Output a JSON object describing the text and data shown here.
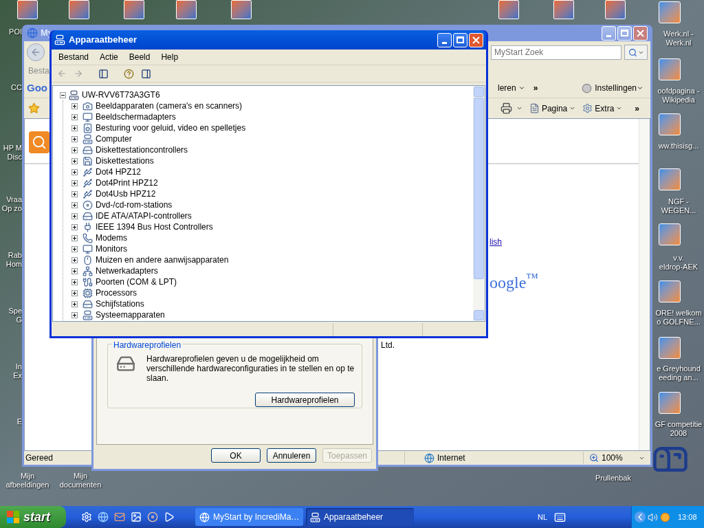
{
  "desktop": {
    "left_icons": [
      {
        "label_lines": [
          "POI"
        ]
      },
      {
        "label_lines": [
          "CC"
        ]
      },
      {
        "label_lines": [
          "HP M",
          "Disc"
        ]
      },
      {
        "label_lines": [
          "Vraa",
          "Op zo"
        ]
      },
      {
        "label_lines": [
          "Rab",
          "Hom"
        ]
      },
      {
        "label_lines": [
          "Spe",
          "G"
        ]
      },
      {
        "label_lines": [
          "In",
          "Ex"
        ]
      },
      {
        "label_lines": [
          "E"
        ]
      }
    ],
    "bottom_icons": [
      {
        "label_lines": [
          "Mijn",
          "afbeeldingen"
        ]
      },
      {
        "label_lines": [
          "Mijn",
          "documenten"
        ]
      }
    ],
    "right_icons": [
      {
        "label_lines": [
          "Werk.nl -",
          "Werk.nl"
        ]
      },
      {
        "label_lines": [
          "oofdpagina -",
          "Wikipedia"
        ]
      },
      {
        "label_lines": [
          "ww.thisisg..."
        ]
      },
      {
        "label_lines": [
          "NGF -",
          "WEGEN..."
        ]
      },
      {
        "label_lines": [
          "v.v.",
          "eldrop-AEK"
        ]
      },
      {
        "label_lines": [
          "ORE! welkom",
          "o GOLFNE..."
        ]
      },
      {
        "label_lines": [
          "e Greyhound",
          "eeding an..."
        ]
      },
      {
        "label_lines": [
          "GF competitie",
          "2008"
        ]
      }
    ],
    "recycle_bin": {
      "label": "Prullenbak"
    }
  },
  "browser_window": {
    "title": "My",
    "search_placeholder": "MyStart Zoek",
    "menu_fragment": "Besta",
    "google_logo": "Goo",
    "toolbar_fragment": "leren",
    "toolbar_overflow": "»",
    "settings": "Instellingen",
    "command_buttons": [
      {
        "label": "Pagina"
      },
      {
        "label": "Extra"
      }
    ],
    "command_overflow": "»",
    "link_fragment": "lish",
    "logo_fragment": "oogle$^{™}$",
    "text_fragment": "Ltd.",
    "status": "Gereed",
    "zone": "Internet",
    "zoom": "100%"
  },
  "system_properties": {
    "group_title": "Hardwareprofielen",
    "description": "Hardwareprofielen geven u de mogelijkheid om verschillende hardwareconfiguraties in te stellen en op te slaan.",
    "group_button": "Hardwareprofielen",
    "buttons": [
      {
        "label": "OK",
        "disabled": false
      },
      {
        "label": "Annuleren",
        "disabled": false
      },
      {
        "label": "Toepassen",
        "disabled": true
      }
    ]
  },
  "device_manager": {
    "title": "Apparaatbeheer",
    "menu": [
      "Bestand",
      "Actie",
      "Beeld",
      "Help"
    ],
    "tree": {
      "label": "UW-RVV6T73A3GT6",
      "expanded": true,
      "children": [
        {
          "label": "Beeldapparaten (camera's en scanners)",
          "expanded": false
        },
        {
          "label": "Beeldschermadapters",
          "expanded": false
        },
        {
          "label": "Besturing voor geluid, video en spelletjes",
          "expanded": false
        },
        {
          "label": "Computer",
          "expanded": false
        },
        {
          "label": "Diskettestationcontrollers",
          "expanded": false
        },
        {
          "label": "Diskettestations",
          "expanded": false
        },
        {
          "label": "Dot4 HPZ12",
          "expanded": false
        },
        {
          "label": "Dot4Print HPZ12",
          "expanded": false
        },
        {
          "label": "Dot4Usb HPZ12",
          "expanded": false
        },
        {
          "label": "Dvd-/cd-rom-stations",
          "expanded": false
        },
        {
          "label": "IDE ATA/ATAPI-controllers",
          "expanded": false
        },
        {
          "label": "IEEE 1394 Bus Host Controllers",
          "expanded": false
        },
        {
          "label": "Modems",
          "expanded": false
        },
        {
          "label": "Monitors",
          "expanded": false
        },
        {
          "label": "Muizen en andere aanwijsapparaten",
          "expanded": false
        },
        {
          "label": "Netwerkadapters",
          "expanded": false
        },
        {
          "label": "Poorten (COM & LPT)",
          "expanded": false
        },
        {
          "label": "Processors",
          "expanded": false
        },
        {
          "label": "Schijfstations",
          "expanded": false
        },
        {
          "label": "Systeemapparaten",
          "expanded": false
        }
      ]
    }
  },
  "taskbar": {
    "start": "start",
    "tasks": [
      {
        "label": "MyStart by IncrediMa…",
        "selected": false
      },
      {
        "label": "Apparaatbeheer",
        "selected": true
      }
    ],
    "language": "NL",
    "clock": "13:08"
  }
}
